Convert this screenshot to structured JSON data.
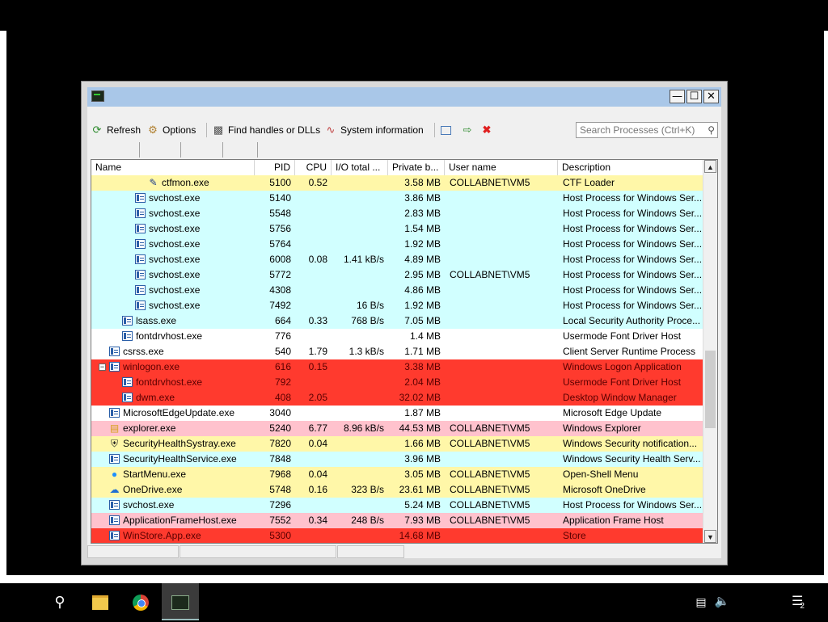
{
  "toolbar": {
    "refresh": "Refresh",
    "options": "Options",
    "find_handles": "Find handles or DLLs",
    "system_info": "System information",
    "search_placeholder": "Search Processes (Ctrl+K)"
  },
  "columns": [
    "Name",
    "PID",
    "CPU",
    "I/O total ...",
    "Private b...",
    "User name",
    "Description"
  ],
  "colors": {
    "yellow": "#fff7a8",
    "cyan": "#d1ffff",
    "pink": "#ffc2cd",
    "red": "#ff3a2e",
    "white": "#ffffff",
    "titlebar": "#a9c7e8"
  },
  "rows": [
    {
      "name": "ctfmon.exe",
      "pid": "5100",
      "cpu": "0.52",
      "io": "",
      "priv": "3.58 MB",
      "user": "COLLABNET\\VM5",
      "desc": "CTF Loader",
      "color": "yellow",
      "indent": 4,
      "icon": "pen"
    },
    {
      "name": "svchost.exe",
      "pid": "5140",
      "cpu": "",
      "io": "",
      "priv": "3.86 MB",
      "user": "",
      "desc": "Host Process for Windows Ser...",
      "color": "cyan",
      "indent": 3,
      "icon": "win"
    },
    {
      "name": "svchost.exe",
      "pid": "5548",
      "cpu": "",
      "io": "",
      "priv": "2.83 MB",
      "user": "",
      "desc": "Host Process for Windows Ser...",
      "color": "cyan",
      "indent": 3,
      "icon": "win"
    },
    {
      "name": "svchost.exe",
      "pid": "5756",
      "cpu": "",
      "io": "",
      "priv": "1.54 MB",
      "user": "",
      "desc": "Host Process for Windows Ser...",
      "color": "cyan",
      "indent": 3,
      "icon": "win"
    },
    {
      "name": "svchost.exe",
      "pid": "5764",
      "cpu": "",
      "io": "",
      "priv": "1.92 MB",
      "user": "",
      "desc": "Host Process for Windows Ser...",
      "color": "cyan",
      "indent": 3,
      "icon": "win"
    },
    {
      "name": "svchost.exe",
      "pid": "6008",
      "cpu": "0.08",
      "io": "1.41 kB/s",
      "priv": "4.89 MB",
      "user": "",
      "desc": "Host Process for Windows Ser...",
      "color": "cyan",
      "indent": 3,
      "icon": "win"
    },
    {
      "name": "svchost.exe",
      "pid": "5772",
      "cpu": "",
      "io": "",
      "priv": "2.95 MB",
      "user": "COLLABNET\\VM5",
      "desc": "Host Process for Windows Ser...",
      "color": "cyan",
      "indent": 3,
      "icon": "win"
    },
    {
      "name": "svchost.exe",
      "pid": "4308",
      "cpu": "",
      "io": "",
      "priv": "4.86 MB",
      "user": "",
      "desc": "Host Process for Windows Ser...",
      "color": "cyan",
      "indent": 3,
      "icon": "win"
    },
    {
      "name": "svchost.exe",
      "pid": "7492",
      "cpu": "",
      "io": "16 B/s",
      "priv": "1.92 MB",
      "user": "",
      "desc": "Host Process for Windows Ser...",
      "color": "cyan",
      "indent": 3,
      "icon": "win"
    },
    {
      "name": "lsass.exe",
      "pid": "664",
      "cpu": "0.33",
      "io": "768 B/s",
      "priv": "7.05 MB",
      "user": "",
      "desc": "Local Security Authority Proce...",
      "color": "cyan",
      "indent": 2,
      "icon": "win"
    },
    {
      "name": "fontdrvhost.exe",
      "pid": "776",
      "cpu": "",
      "io": "",
      "priv": "1.4 MB",
      "user": "",
      "desc": "Usermode Font Driver Host",
      "color": "white",
      "indent": 2,
      "icon": "win"
    },
    {
      "name": "csrss.exe",
      "pid": "540",
      "cpu": "1.79",
      "io": "1.3 kB/s",
      "priv": "1.71 MB",
      "user": "",
      "desc": "Client Server Runtime Process",
      "color": "white",
      "indent": 1,
      "icon": "win"
    },
    {
      "name": "winlogon.exe",
      "pid": "616",
      "cpu": "0.15",
      "io": "",
      "priv": "3.38 MB",
      "user": "",
      "desc": "Windows Logon Application",
      "color": "red",
      "indent": 1,
      "icon": "win",
      "expander": "−"
    },
    {
      "name": "fontdrvhost.exe",
      "pid": "792",
      "cpu": "",
      "io": "",
      "priv": "2.04 MB",
      "user": "",
      "desc": "Usermode Font Driver Host",
      "color": "red",
      "indent": 2,
      "icon": "win"
    },
    {
      "name": "dwm.exe",
      "pid": "408",
      "cpu": "2.05",
      "io": "",
      "priv": "32.02 MB",
      "user": "",
      "desc": "Desktop Window Manager",
      "color": "red",
      "indent": 2,
      "icon": "win"
    },
    {
      "name": "MicrosoftEdgeUpdate.exe",
      "pid": "3040",
      "cpu": "",
      "io": "",
      "priv": "1.87 MB",
      "user": "",
      "desc": "Microsoft Edge Update",
      "color": "white",
      "indent": 1,
      "icon": "win"
    },
    {
      "name": "explorer.exe",
      "pid": "5240",
      "cpu": "6.77",
      "io": "8.96 kB/s",
      "priv": "44.53 MB",
      "user": "COLLABNET\\VM5",
      "desc": "Windows Explorer",
      "color": "pink",
      "indent": 1,
      "icon": "folder"
    },
    {
      "name": "SecurityHealthSystray.exe",
      "pid": "7820",
      "cpu": "0.04",
      "io": "",
      "priv": "1.66 MB",
      "user": "COLLABNET\\VM5",
      "desc": "Windows Security notification...",
      "color": "yellow",
      "indent": 1,
      "icon": "shield"
    },
    {
      "name": "SecurityHealthService.exe",
      "pid": "7848",
      "cpu": "",
      "io": "",
      "priv": "3.96 MB",
      "user": "",
      "desc": "Windows Security Health Serv...",
      "color": "cyan",
      "indent": 1,
      "icon": "win"
    },
    {
      "name": "StartMenu.exe",
      "pid": "7968",
      "cpu": "0.04",
      "io": "",
      "priv": "3.05 MB",
      "user": "COLLABNET\\VM5",
      "desc": "Open-Shell Menu",
      "color": "yellow",
      "indent": 1,
      "icon": "globe"
    },
    {
      "name": "OneDrive.exe",
      "pid": "5748",
      "cpu": "0.16",
      "io": "323 B/s",
      "priv": "23.61 MB",
      "user": "COLLABNET\\VM5",
      "desc": "Microsoft OneDrive",
      "color": "yellow",
      "indent": 1,
      "icon": "cloud"
    },
    {
      "name": "svchost.exe",
      "pid": "7296",
      "cpu": "",
      "io": "",
      "priv": "5.24 MB",
      "user": "COLLABNET\\VM5",
      "desc": "Host Process for Windows Ser...",
      "color": "cyan",
      "indent": 1,
      "icon": "win"
    },
    {
      "name": "ApplicationFrameHost.exe",
      "pid": "7552",
      "cpu": "0.34",
      "io": "248 B/s",
      "priv": "7.93 MB",
      "user": "COLLABNET\\VM5",
      "desc": "Application Frame Host",
      "color": "pink",
      "indent": 1,
      "icon": "win"
    },
    {
      "name": "WinStore.App.exe",
      "pid": "5300",
      "cpu": "",
      "io": "",
      "priv": "14.68 MB",
      "user": "",
      "desc": "Store",
      "color": "red",
      "indent": 1,
      "icon": "win"
    }
  ],
  "taskbar": {
    "notification_count": "2"
  }
}
